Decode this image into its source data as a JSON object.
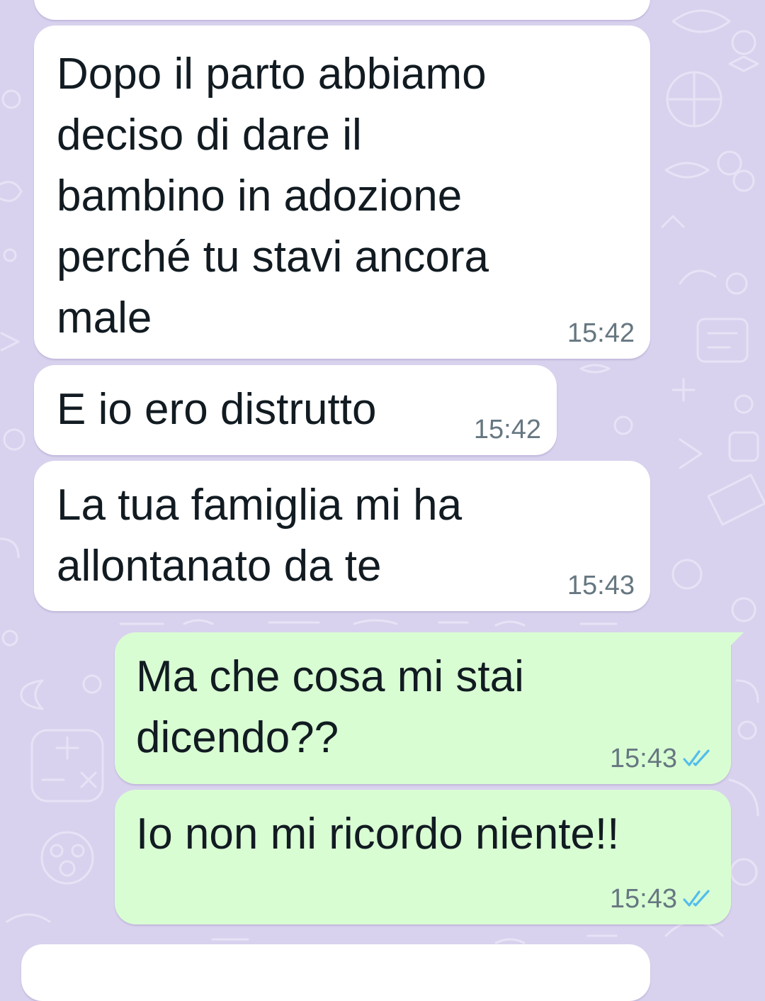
{
  "messages": [
    {
      "direction": "incoming",
      "text": "",
      "time": ""
    },
    {
      "direction": "incoming",
      "text": "Dopo il parto abbiamo\ndeciso di dare il\nbambino in adozione\nperché tu stavi ancora\nmale",
      "time": "15:42"
    },
    {
      "direction": "incoming",
      "text": "E io ero distrutto",
      "time": "15:42"
    },
    {
      "direction": "incoming",
      "text": "La tua famiglia mi ha\nallontanato da te",
      "time": "15:43"
    },
    {
      "direction": "outgoing",
      "text": "Ma che cosa mi stai\ndicendo??",
      "time": "15:43",
      "status": "read-double-check-icon"
    },
    {
      "direction": "outgoing",
      "text": "Io non mi ricordo niente!!",
      "time": "15:43",
      "status": "read-double-check-icon"
    },
    {
      "direction": "incoming",
      "text": "",
      "time": ""
    }
  ],
  "colors": {
    "wallpaper": "#d9d2ee",
    "incoming_bubble": "#ffffff",
    "outgoing_bubble": "#d9fdd3",
    "text": "#111b21",
    "timestamp": "#667781",
    "read_ticks": "#53bdeb"
  }
}
